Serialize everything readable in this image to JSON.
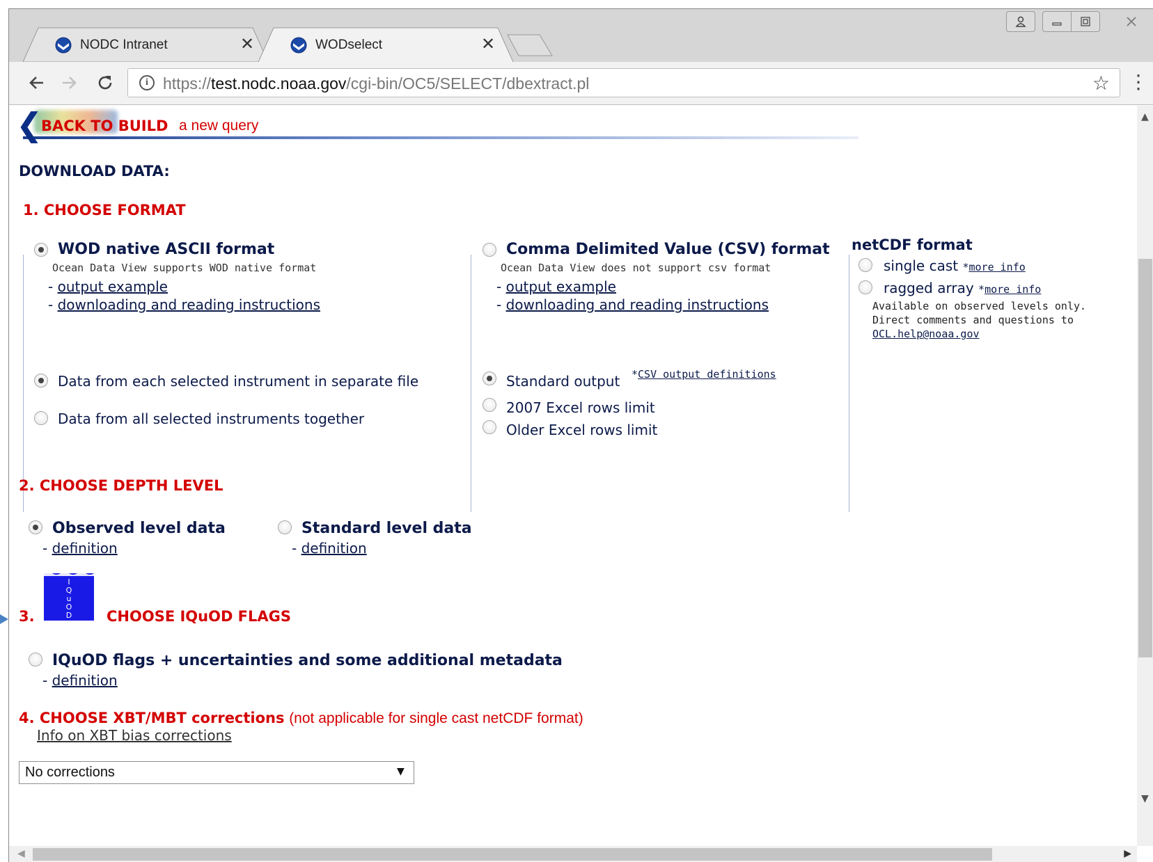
{
  "browser": {
    "tabs": [
      {
        "title": "NODC Intranet",
        "close": "✕"
      },
      {
        "title": "WODselect",
        "close": "✕"
      }
    ],
    "url_scheme": "https://",
    "url_host": "test.nodc.noaa.gov",
    "url_path": "/cgi-bin/OC5/SELECT/dbextract.pl",
    "icons": {
      "back": "arrow-left-icon",
      "forward": "arrow-right-icon",
      "reload": "reload-icon",
      "info": "info-icon",
      "star": "star-icon",
      "menu": "kebab-menu-icon"
    }
  },
  "banner": {
    "back_label": "BACK TO BUILD",
    "back_suffix": "a new query"
  },
  "page": {
    "download_heading": "DOWNLOAD DATA:",
    "section1": {
      "title": "1. CHOOSE FORMAT",
      "ascii": {
        "label": "WOD native ASCII format",
        "note": "Ocean Data View supports WOD native format",
        "link1": "output example",
        "link2": "downloading and reading instructions",
        "selected": true
      },
      "csv": {
        "label": "Comma Delimited Value (CSV) format",
        "note": "Ocean Data View does not support csv format",
        "link1": "output example",
        "link2": "downloading and reading instructions",
        "selected": false
      },
      "netcdf": {
        "heading": "netCDF format",
        "single_cast": "single cast",
        "ragged_array": "ragged array",
        "more_info": "more info",
        "note_line1": "Available on observed levels only.",
        "note_line2": "Direct comments and questions to",
        "email": "OCL.help@noaa.gov"
      },
      "ascii_options": [
        {
          "label": "Data from each selected instrument in separate file",
          "selected": true
        },
        {
          "label": "Data from all selected instruments together",
          "selected": false
        }
      ],
      "csv_options": [
        {
          "label": "Standard output",
          "selected": true
        },
        {
          "label": "2007 Excel rows limit",
          "selected": false
        },
        {
          "label": "Older Excel rows limit",
          "selected": false
        }
      ],
      "csv_definitions_link": "CSV output definitions"
    },
    "section2": {
      "title": "2. CHOOSE DEPTH LEVEL",
      "observed": {
        "label": "Observed level data",
        "link": "definition",
        "selected": true
      },
      "standard": {
        "label": "Standard level data",
        "link": "definition",
        "selected": false
      }
    },
    "section3": {
      "number": "3.",
      "title": "CHOOSE IQuOD FLAGS",
      "logo_text": "IQuOD",
      "option": {
        "label": "IQuOD flags + uncertainties and some additional metadata",
        "link": "definition",
        "selected": false
      }
    },
    "section4": {
      "title": "4. CHOOSE XBT/MBT corrections",
      "note": "(not applicable for single cast netCDF format)",
      "info_link": "Info on XBT bias corrections",
      "select_value": "No corrections",
      "select_arrow": "▼"
    }
  },
  "colors": {
    "section_red": "#d40000",
    "text_navy": "#0c1a4a",
    "tabstrip": "#d6d6d6"
  }
}
